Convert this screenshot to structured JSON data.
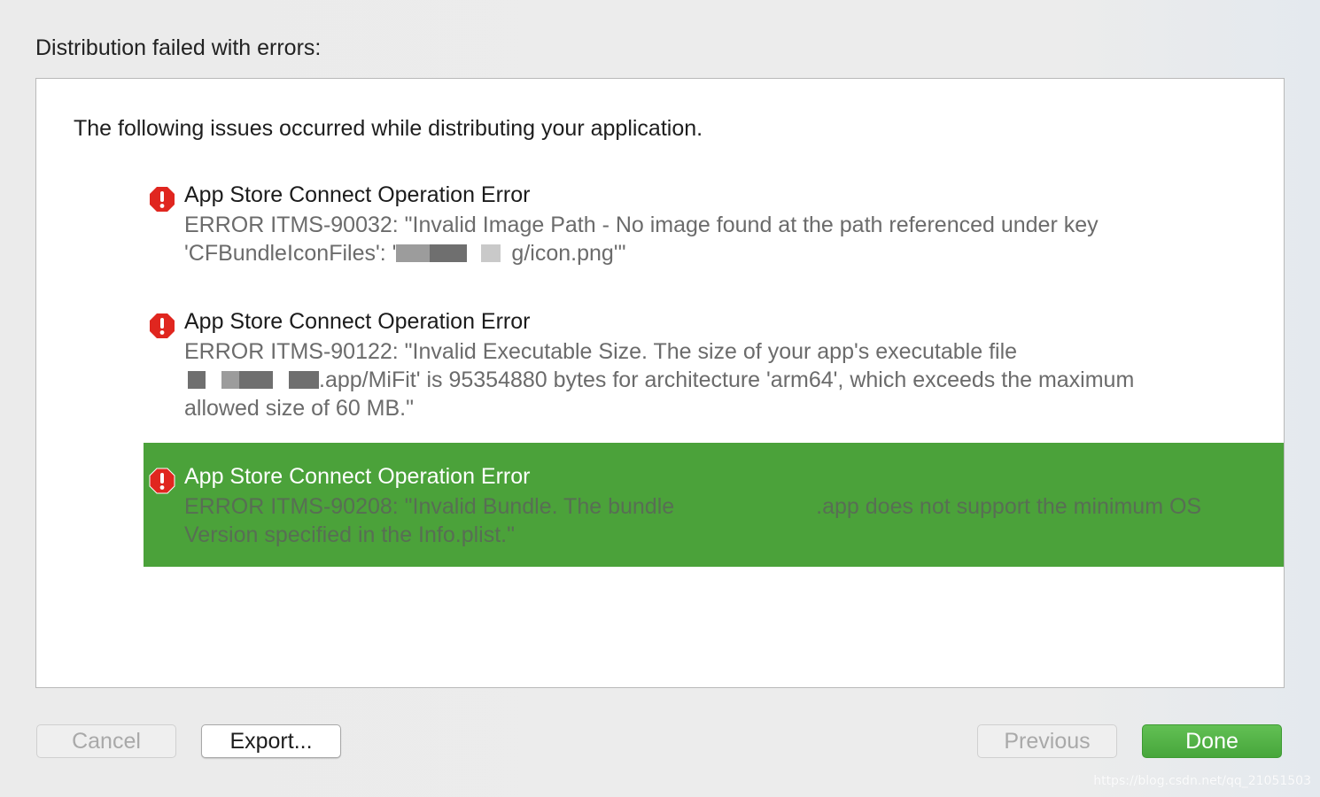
{
  "header": {
    "title": "Distribution failed with errors:"
  },
  "panel": {
    "intro": "The following issues occurred while distributing your application.",
    "issues": [
      {
        "icon": "error-icon",
        "title": "App Store Connect Operation Error",
        "line1": "ERROR ITMS-90032: \"Invalid Image Path - No image found at the path referenced under key",
        "line2_prefix": "'CFBundleIconFiles': '",
        "line2_suffix": "g/icon.png'\""
      },
      {
        "icon": "error-icon",
        "title": "App Store Connect Operation Error",
        "line1": "ERROR ITMS-90122: \"Invalid Executable Size. The size of your app's executable file",
        "line2_suffix": ".app/MiFit' is 95354880 bytes for architecture 'arm64', which exceeds the maximum",
        "line3": "allowed size of 60 MB.\""
      },
      {
        "icon": "error-icon",
        "selected": true,
        "title": "App Store Connect Operation Error",
        "line1_prefix": "ERROR ITMS-90208: \"Invalid Bundle. The bundle",
        "line1_suffix": ".app does not support the minimum OS",
        "line2": "Version specified in the Info.plist.\""
      }
    ]
  },
  "buttons": {
    "cancel": "Cancel",
    "export": "Export...",
    "previous": "Previous",
    "done": "Done"
  },
  "watermark": "https://blog.csdn.net/qq_21051503",
  "colors": {
    "selection": "#4ba23a",
    "primary_button": "#52b144",
    "error_icon": "#e0261f"
  }
}
